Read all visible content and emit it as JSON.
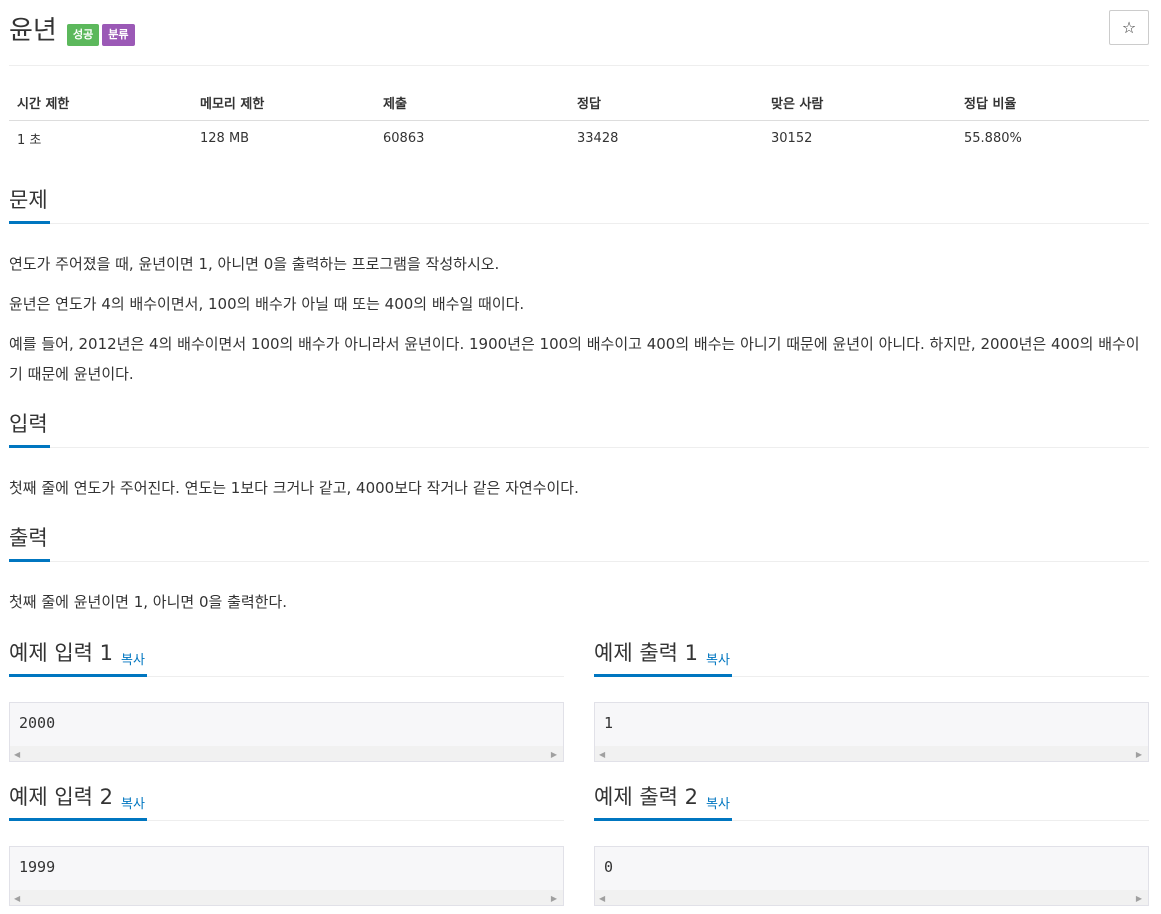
{
  "header": {
    "title": "윤년",
    "badges": [
      "성공",
      "분류"
    ],
    "star_icon": "☆"
  },
  "info_table": {
    "headers": [
      "시간 제한",
      "메모리 제한",
      "제출",
      "정답",
      "맞은 사람",
      "정답 비율"
    ],
    "values": [
      "1 초",
      "128 MB",
      "60863",
      "33428",
      "30152",
      "55.880%"
    ]
  },
  "problem": {
    "heading": "문제",
    "paragraphs": [
      "연도가 주어졌을 때, 윤년이면 1, 아니면 0을 출력하는 프로그램을 작성하시오.",
      "윤년은 연도가 4의 배수이면서, 100의 배수가 아닐 때 또는 400의 배수일 때이다.",
      "예를 들어, 2012년은 4의 배수이면서 100의 배수가 아니라서 윤년이다. 1900년은 100의 배수이고 400의 배수는 아니기 때문에 윤년이 아니다. 하지만, 2000년은 400의 배수이기 때문에 윤년이다."
    ]
  },
  "input_section": {
    "heading": "입력",
    "text": "첫째 줄에 연도가 주어진다. 연도는 1보다 크거나 같고, 4000보다 작거나 같은 자연수이다."
  },
  "output_section": {
    "heading": "출력",
    "text": "첫째 줄에 윤년이면 1, 아니면 0을 출력한다."
  },
  "samples": {
    "copy_label": "복사",
    "input1": {
      "heading": "예제 입력 1",
      "value": "2000"
    },
    "output1": {
      "heading": "예제 출력 1",
      "value": "1"
    },
    "input2": {
      "heading": "예제 입력 2",
      "value": "1999"
    },
    "output2": {
      "heading": "예제 출력 2",
      "value": "0"
    }
  }
}
